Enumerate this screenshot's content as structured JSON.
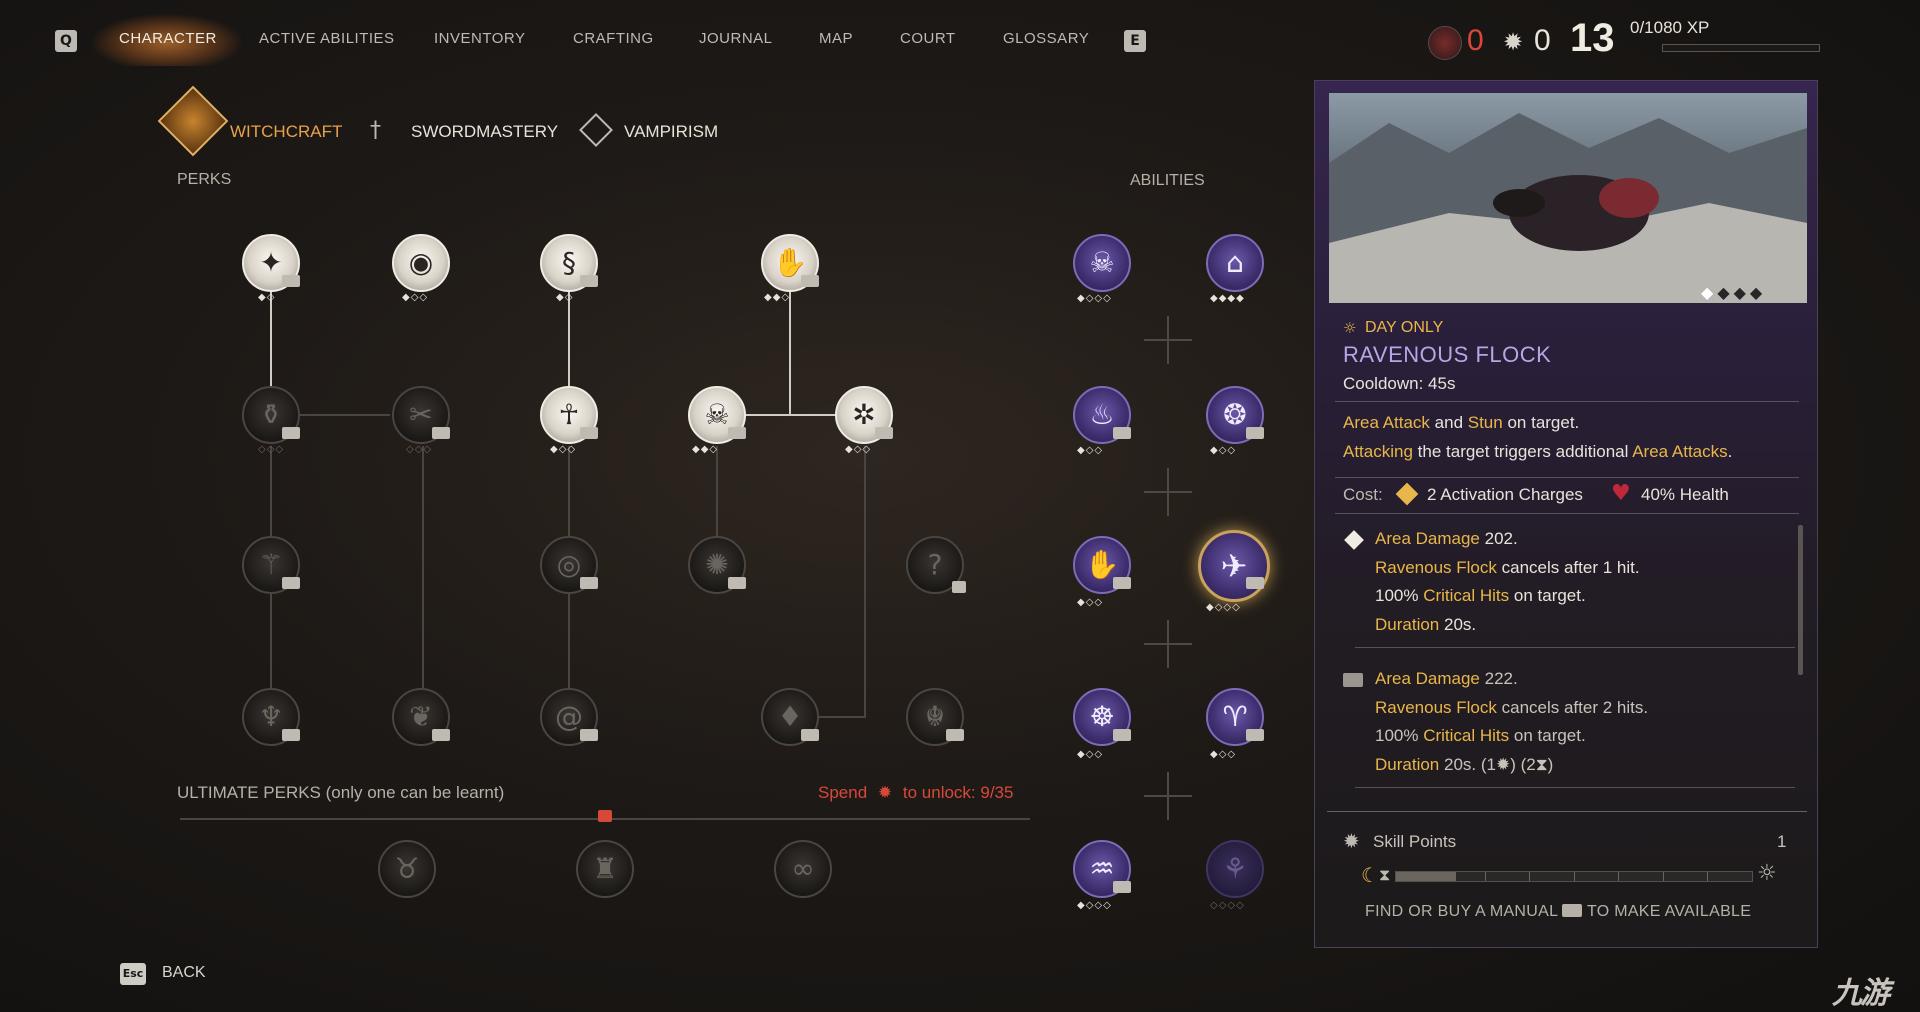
{
  "nav": {
    "left_key": "Q",
    "right_key": "E",
    "tabs": [
      "CHARACTER",
      "ACTIVE ABILITIES",
      "INVENTORY",
      "CRAFTING",
      "JOURNAL",
      "MAP",
      "COURT",
      "GLOSSARY"
    ]
  },
  "status": {
    "blood_count": "0",
    "skill_count": "0",
    "level": "13",
    "xp": "0/1080 XP"
  },
  "subtabs": [
    "WITCHCRAFT",
    "SWORDMASTERY",
    "VAMPIRISM"
  ],
  "labels": {
    "perks": "PERKS",
    "abilities": "ABILITIES",
    "ultimate": "ULTIMATE PERKS (only one can be learnt)",
    "spend": "Spend",
    "unlock": "to unlock: 9/35"
  },
  "panel": {
    "tag": "DAY ONLY",
    "title": "RAVENOUS FLOCK",
    "cooldown": "Cooldown: 45s",
    "desc1_a": "Area Attack",
    "desc1_b": " and ",
    "desc1_c": "Stun",
    "desc1_d": " on target.",
    "desc2_a": "Attacking",
    "desc2_b": " the target triggers additional ",
    "desc2_c": "Area Attacks",
    "desc2_d": ".",
    "cost_label": "Cost:",
    "cost_charges": "2 Activation Charges",
    "cost_health": "40% Health",
    "tier1": {
      "dmg_label": "Area Damage",
      "dmg_value": " 202.",
      "cancel_name": "Ravenous Flock",
      "cancel_text": " cancels after 1 hit.",
      "crit_pre": "100% ",
      "crit_name": "Critical Hits",
      "crit_post": " on target.",
      "dur_label": "Duration",
      "dur_value": " 20s."
    },
    "tier2": {
      "dmg_label": "Area Damage",
      "dmg_value": " 222.",
      "cancel_name": "Ravenous Flock",
      "cancel_text": " cancels after 2 hits.",
      "crit_pre": "100% ",
      "crit_name": "Critical Hits",
      "crit_post": " on target.",
      "dur_label": "Duration",
      "dur_value": " 20s.",
      "req_a": "(1",
      "req_b": ") (2",
      "req_c": ")"
    },
    "skill_points_label": "Skill Points",
    "skill_points_value": "1",
    "manual_a": "FIND OR BUY A MANUAL",
    "manual_b": "TO MAKE AVAILABLE"
  },
  "footer": {
    "key": "Esc",
    "back": "BACK"
  },
  "watermark": "九游",
  "colors": {
    "accent_gold": "#e8b64a",
    "accent_red": "#d8483a",
    "panel_purple": "#36254e",
    "title_purple": "#b9a5e6"
  },
  "icons": {
    "perk_row1": [
      "dagger-emblem-icon",
      "evil-eye-icon",
      "spiral-head-icon",
      "eye-hand-icon"
    ],
    "perk_row2": [
      "cauldron-icon",
      "crossed-tools-icon",
      "ankh-figure-icon",
      "skull-bones-icon",
      "trident-sigil-icon"
    ],
    "perk_row3": [
      "thorn-figure-icon",
      "claw-eye-icon",
      "fire-hand-icon",
      "locked-unknown-icon"
    ],
    "perk_row4": [
      "fanged-demon-icon",
      "raven-tail-icon",
      "vortex-icon",
      "blood-drop-icon",
      "burning-skull-icon"
    ],
    "ultimates": [
      "horned-beast-icon",
      "armored-knight-icon",
      "dragon-coil-icon"
    ],
    "abilities": [
      "skull-ability-icon",
      "keyhole-ability-icon",
      "flame-ability-icon",
      "dragon-ability-icon",
      "claw-ability-icon",
      "ravenous-flock-icon",
      "palm-ability-icon",
      "horned-mask-ability-icon",
      "serpent-ability-icon",
      "shadow-ability-icon"
    ]
  }
}
